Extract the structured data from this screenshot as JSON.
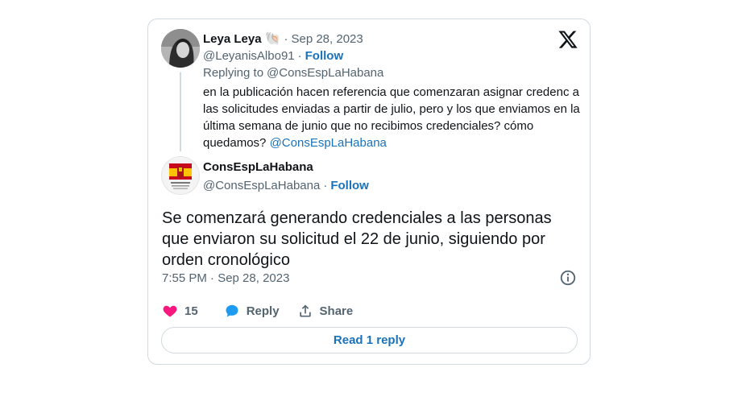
{
  "reply_tweet": {
    "author_name": "Leya Leya",
    "badge_emoji": "🐚",
    "separator": "·",
    "date": "Sep 28, 2023",
    "handle": "@LeyanisAlbo91",
    "follow_label": "Follow",
    "replying_to_prefix": "Replying to",
    "replying_to_handle": "@ConsEspLaHabana",
    "text": "en la publicación hacen referencia que comenzaran  asignar credenc a las solicitudes enviadas a partir de julio, pero y los que enviamos en la última semana de junio que no recibimos credenciales? cómo quedamos?",
    "mention": "@ConsEspLaHabana"
  },
  "main_tweet": {
    "author_name": "ConsEspLaHabana",
    "handle": "@ConsEspLaHabana",
    "separator": "·",
    "follow_label": "Follow",
    "text": "Se comenzará generando credenciales a las personas que enviaron su solicitud el 22 de junio, siguiendo por orden cronológico",
    "timestamp": "7:55 PM · Sep 28, 2023"
  },
  "actions": {
    "like_count": "15",
    "reply_label": "Reply",
    "share_label": "Share"
  },
  "read_replies_label": "Read 1 reply",
  "icons": {
    "brand": "x-logo-icon",
    "like": "heart-icon",
    "reply": "speech-bubble-icon",
    "share": "share-upload-icon",
    "info": "info-icon"
  },
  "colors": {
    "heart": "#f91880",
    "reply_bubble": "#1d9bf0",
    "link": "#1a72b8",
    "muted": "#536471",
    "border": "#cfd9de"
  }
}
